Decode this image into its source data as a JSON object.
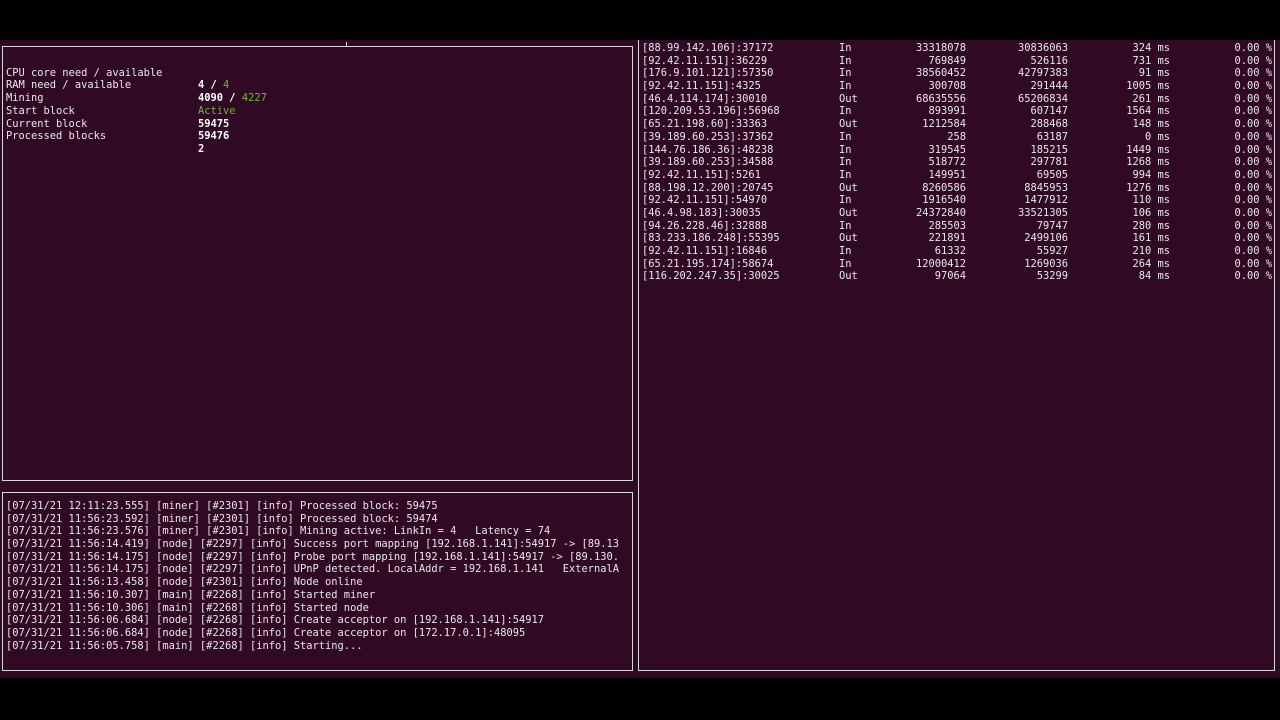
{
  "status": {
    "rows": [
      {
        "label": "CPU core need / available",
        "need": "4",
        "sep": " / ",
        "avail": "4"
      },
      {
        "label": "RAM need / available",
        "need": "4090",
        "sep": " / ",
        "avail": "4227"
      },
      {
        "label": "Mining",
        "value": "Active"
      },
      {
        "label": "Start block",
        "value": "59475"
      },
      {
        "label": "Current block",
        "value": "59476"
      },
      {
        "label": "Processed blocks",
        "value": "2"
      }
    ]
  },
  "peers": [
    {
      "addr": "[88.99.142.106]:37172",
      "dir": "In",
      "bytes_in": "33318078",
      "bytes_out": "30836063",
      "latency": "324 ms",
      "loss": "0.00 %"
    },
    {
      "addr": "[92.42.11.151]:36229",
      "dir": "In",
      "bytes_in": "769849",
      "bytes_out": "526116",
      "latency": "731 ms",
      "loss": "0.00 %"
    },
    {
      "addr": "[176.9.101.121]:57350",
      "dir": "In",
      "bytes_in": "38560452",
      "bytes_out": "42797383",
      "latency": "91 ms",
      "loss": "0.00 %"
    },
    {
      "addr": "[92.42.11.151]:4325",
      "dir": "In",
      "bytes_in": "300708",
      "bytes_out": "291444",
      "latency": "1005 ms",
      "loss": "0.00 %"
    },
    {
      "addr": "[46.4.114.174]:30010",
      "dir": "Out",
      "bytes_in": "68635556",
      "bytes_out": "65206834",
      "latency": "261 ms",
      "loss": "0.00 %"
    },
    {
      "addr": "[120.209.53.196]:56968",
      "dir": "In",
      "bytes_in": "893991",
      "bytes_out": "607147",
      "latency": "1564 ms",
      "loss": "0.00 %"
    },
    {
      "addr": "[65.21.198.60]:33363",
      "dir": "Out",
      "bytes_in": "1212584",
      "bytes_out": "288468",
      "latency": "148 ms",
      "loss": "0.00 %"
    },
    {
      "addr": "[39.189.60.253]:37362",
      "dir": "In",
      "bytes_in": "258",
      "bytes_out": "63187",
      "latency": "0 ms",
      "loss": "0.00 %"
    },
    {
      "addr": "[144.76.186.36]:48238",
      "dir": "In",
      "bytes_in": "319545",
      "bytes_out": "185215",
      "latency": "1449 ms",
      "loss": "0.00 %"
    },
    {
      "addr": "[39.189.60.253]:34588",
      "dir": "In",
      "bytes_in": "518772",
      "bytes_out": "297781",
      "latency": "1268 ms",
      "loss": "0.00 %"
    },
    {
      "addr": "[92.42.11.151]:5261",
      "dir": "In",
      "bytes_in": "149951",
      "bytes_out": "69505",
      "latency": "994 ms",
      "loss": "0.00 %"
    },
    {
      "addr": "[88.198.12.200]:20745",
      "dir": "Out",
      "bytes_in": "8260586",
      "bytes_out": "8845953",
      "latency": "1276 ms",
      "loss": "0.00 %"
    },
    {
      "addr": "[92.42.11.151]:54970",
      "dir": "In",
      "bytes_in": "1916540",
      "bytes_out": "1477912",
      "latency": "110 ms",
      "loss": "0.00 %"
    },
    {
      "addr": "[46.4.98.183]:30035",
      "dir": "Out",
      "bytes_in": "24372840",
      "bytes_out": "33521305",
      "latency": "106 ms",
      "loss": "0.00 %"
    },
    {
      "addr": "[94.26.228.46]:32888",
      "dir": "In",
      "bytes_in": "285503",
      "bytes_out": "79747",
      "latency": "280 ms",
      "loss": "0.00 %"
    },
    {
      "addr": "[83.233.186.248]:55395",
      "dir": "Out",
      "bytes_in": "221891",
      "bytes_out": "2499106",
      "latency": "161 ms",
      "loss": "0.00 %"
    },
    {
      "addr": "[92.42.11.151]:16846",
      "dir": "In",
      "bytes_in": "61332",
      "bytes_out": "55927",
      "latency": "210 ms",
      "loss": "0.00 %"
    },
    {
      "addr": "[65.21.195.174]:58674",
      "dir": "In",
      "bytes_in": "12000412",
      "bytes_out": "1269036",
      "latency": "264 ms",
      "loss": "0.00 %"
    },
    {
      "addr": "[116.202.247.35]:30025",
      "dir": "Out",
      "bytes_in": "97064",
      "bytes_out": "53299",
      "latency": "84 ms",
      "loss": "0.00 %"
    }
  ],
  "log": [
    "[07/31/21 12:11:23.555] [miner] [#2301] [info] Processed block: 59475",
    "[07/31/21 11:56:23.592] [miner] [#2301] [info] Processed block: 59474",
    "[07/31/21 11:56:23.576] [miner] [#2301] [info] Mining active: LinkIn = 4   Latency = 74",
    "[07/31/21 11:56:14.419] [node] [#2297] [info] Success port mapping [192.168.1.141]:54917 -> [89.13",
    "[07/31/21 11:56:14.175] [node] [#2297] [info] Probe port mapping [192.168.1.141]:54917 -> [89.130.",
    "[07/31/21 11:56:14.175] [node] [#2297] [info] UPnP detected. LocalAddr = 192.168.1.141   ExternalA",
    "[07/31/21 11:56:13.458] [node] [#2301] [info] Node online",
    "[07/31/21 11:56:10.307] [main] [#2268] [info] Started miner",
    "[07/31/21 11:56:10.306] [main] [#2268] [info] Started node",
    "[07/31/21 11:56:06.684] [node] [#2268] [info] Create acceptor on [192.168.1.141]:54917",
    "[07/31/21 11:56:06.684] [node] [#2268] [info] Create acceptor on [172.17.0.1]:48095",
    "[07/31/21 11:56:05.758] [main] [#2268] [info] Starting..."
  ],
  "colors": {
    "background": "#300a24",
    "accent_green": "#6fb33d",
    "border": "#d8d8d8"
  }
}
